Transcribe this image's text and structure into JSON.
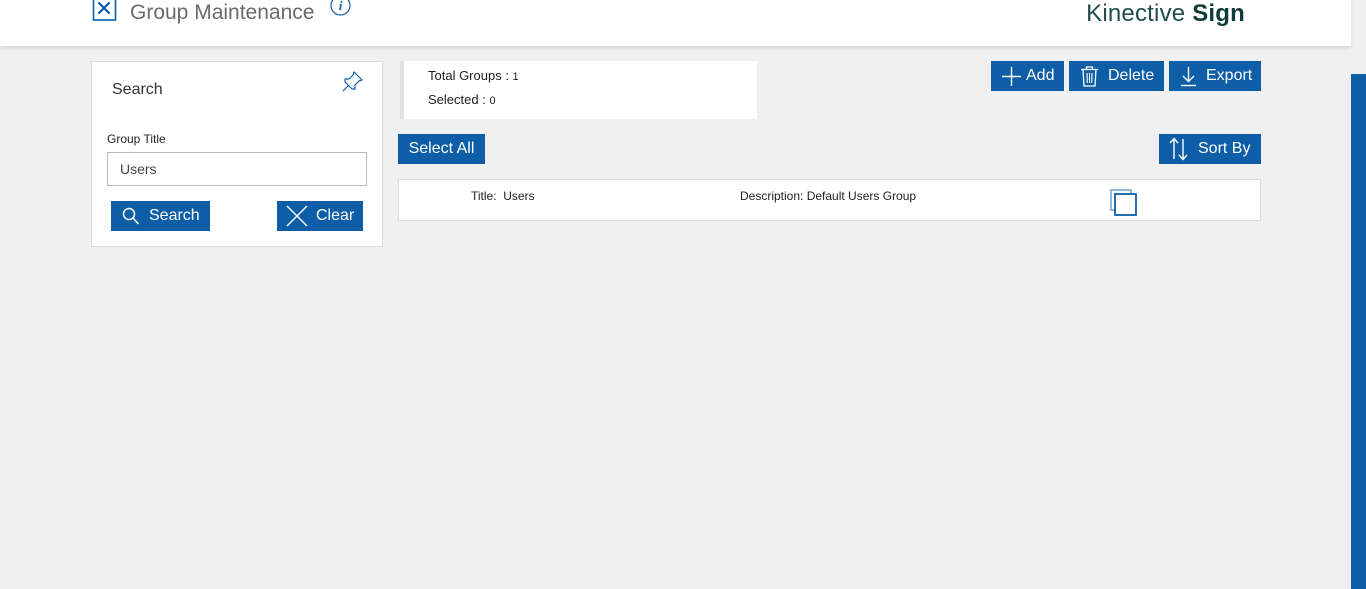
{
  "header": {
    "page_title": "Group Maintenance",
    "brand_light": "Kinective",
    "brand_bold": "Sign"
  },
  "search_panel": {
    "title": "Search",
    "field_label": "Group Title",
    "field_value": "Users",
    "search_label": "Search",
    "clear_label": "Clear"
  },
  "stats": {
    "total_label": "Total Groups : ",
    "total_value": "1",
    "selected_label": "Selected : ",
    "selected_value": "0"
  },
  "toolbar": {
    "add_label": "Add",
    "delete_label": "Delete",
    "export_label": "Export",
    "select_all_label": "Select All",
    "sort_label": "Sort By"
  },
  "results": [
    {
      "title_label": "Title:",
      "title_value": "Users",
      "description_label": "Description:",
      "description_value": "Default Users Group"
    }
  ],
  "colors": {
    "accent": "#0d5ea6",
    "background": "#f0f0f0",
    "brand_text": "#0e3b3a"
  },
  "icons": [
    "tools-icon",
    "info-icon",
    "pin-icon",
    "search-icon",
    "close-icon",
    "plus-icon",
    "trash-icon",
    "download-icon",
    "sort-icon",
    "copy-icon"
  ]
}
